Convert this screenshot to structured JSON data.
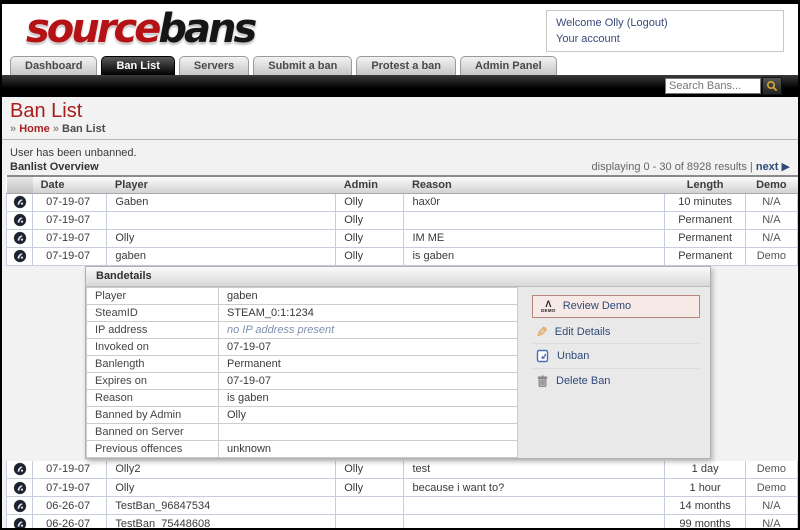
{
  "header": {
    "logo_part1": "source",
    "logo_part2": "bans",
    "welcome_text": "Welcome Olly ",
    "logout_label": "(Logout)",
    "account_label": "Your account"
  },
  "nav": {
    "tabs": [
      {
        "label": "Dashboard",
        "active": false
      },
      {
        "label": "Ban List",
        "active": true
      },
      {
        "label": "Servers",
        "active": false
      },
      {
        "label": "Submit a ban",
        "active": false
      },
      {
        "label": "Protest a ban",
        "active": false
      },
      {
        "label": "Admin Panel",
        "active": false
      }
    ]
  },
  "search": {
    "placeholder": "Search Bans...",
    "icon": "magnifier-icon"
  },
  "page": {
    "title": "Ban List",
    "breadcrumb": {
      "sep1": "»",
      "home": "Home",
      "sep2": "»",
      "current": "Ban List"
    }
  },
  "main": {
    "flash_message": "User has been unbanned.",
    "section_title": "Banlist Overview",
    "pagination": {
      "info": "displaying 0 - 30 of 8928 results",
      "separator": "|",
      "next_label": "next",
      "next_arrow": "▶"
    }
  },
  "table": {
    "columns": {
      "date": "Date",
      "player": "Player",
      "admin": "Admin",
      "reason": "Reason",
      "length": "Length",
      "demo": "Demo"
    },
    "rows_top": [
      {
        "date": "07-19-07",
        "player": "Gaben",
        "admin": "Olly",
        "reason": "hax0r",
        "length": "10 minutes",
        "demo": "N/A",
        "demo_link": false
      },
      {
        "date": "07-19-07",
        "player": "",
        "admin": "Olly",
        "reason": "",
        "length": "Permanent",
        "demo": "N/A",
        "demo_link": false
      },
      {
        "date": "07-19-07",
        "player": "Olly",
        "admin": "Olly",
        "reason": "IM ME",
        "length": "Permanent",
        "demo": "N/A",
        "demo_link": false
      },
      {
        "date": "07-19-07",
        "player": "gaben",
        "admin": "Olly",
        "reason": "is gaben",
        "length": "Permanent",
        "demo": "Demo",
        "demo_link": true
      }
    ],
    "rows_bottom": [
      {
        "date": "07-19-07",
        "player": "Olly2",
        "admin": "Olly",
        "reason": "test",
        "length": "1 day",
        "demo": "Demo",
        "demo_link": true
      },
      {
        "date": "07-19-07",
        "player": "Olly",
        "admin": "Olly",
        "reason": "because i want to?",
        "length": "1 hour",
        "demo": "Demo",
        "demo_link": true
      },
      {
        "date": "06-26-07",
        "player": "TestBan_96847534",
        "admin": "",
        "reason": "",
        "length": "14 months",
        "demo": "N/A",
        "demo_link": false
      },
      {
        "date": "06-26-07",
        "player": "TestBan_75448608",
        "admin": "",
        "reason": "",
        "length": "99 months",
        "demo": "N/A",
        "demo_link": false
      }
    ]
  },
  "details": {
    "title": "Bandetails",
    "fields": [
      {
        "label": "Player",
        "value": "gaben",
        "muted": false
      },
      {
        "label": "SteamID",
        "value": "STEAM_0:1:1234",
        "muted": false
      },
      {
        "label": "IP address",
        "value": "no IP address present",
        "muted": true
      },
      {
        "label": "Invoked on",
        "value": "07-19-07",
        "muted": false
      },
      {
        "label": "Banlength",
        "value": "Permanent",
        "muted": false
      },
      {
        "label": "Expires on",
        "value": "07-19-07",
        "muted": false
      },
      {
        "label": "Reason",
        "value": "is gaben",
        "muted": false
      },
      {
        "label": "Banned by Admin",
        "value": "Olly",
        "muted": false
      },
      {
        "label": "Banned on Server",
        "value": "",
        "muted": false
      },
      {
        "label": "Previous offences",
        "value": "unknown",
        "muted": false
      }
    ],
    "actions": {
      "review_demo": "Review Demo",
      "edit_details": "Edit Details",
      "unban": "Unban",
      "delete_ban": "Delete Ban"
    },
    "demo_icon_glyph": "Λ",
    "demo_icon_text": "DEMO",
    "pencil_glyph": "✎"
  },
  "colors": {
    "brand_red": "#b51216",
    "brand_black": "#161616",
    "title_red": "#a81c1c",
    "link_navy": "#2f4a7a",
    "row_border": "#c6cdde",
    "highlight_border": "#b5857a",
    "highlight_bg": "#f7e9e5"
  }
}
